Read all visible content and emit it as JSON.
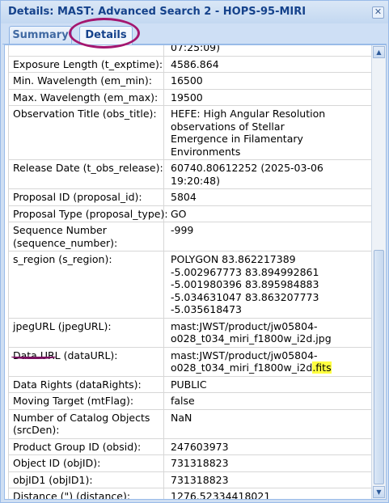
{
  "window": {
    "title": "Details: MAST: Advanced Search 2 - HOPS-95-MIRI",
    "close_glyph": "✕"
  },
  "tabs": [
    {
      "label": "Summary",
      "active": false
    },
    {
      "label": "Details",
      "active": true
    }
  ],
  "rows": [
    {
      "label": [
        ""
      ],
      "value": [
        "07:25:09)"
      ]
    },
    {
      "label": [
        "Exposure Length (t_exptime):"
      ],
      "value": [
        "4586.864"
      ]
    },
    {
      "label": [
        "Min. Wavelength (em_min):"
      ],
      "value": [
        "16500"
      ]
    },
    {
      "label": [
        "Max. Wavelength (em_max):"
      ],
      "value": [
        "19500"
      ]
    },
    {
      "label": [
        "Observation Title (obs_title):"
      ],
      "value": [
        "HEFE: High Angular Resolution",
        "observations of Stellar",
        "Emergence in Filamentary",
        "Environments"
      ]
    },
    {
      "label": [
        "Release Date (t_obs_release):"
      ],
      "value": [
        "60740.80612252 (2025-03-06",
        "19:20:48)"
      ]
    },
    {
      "label": [
        "Proposal ID (proposal_id):"
      ],
      "value": [
        "5804"
      ]
    },
    {
      "label": [
        "Proposal Type (proposal_type):"
      ],
      "value": [
        "GO"
      ]
    },
    {
      "label": [
        "Sequence Number",
        "(sequence_number):"
      ],
      "value": [
        "-999"
      ]
    },
    {
      "label": [
        "s_region (s_region):"
      ],
      "value": [
        "POLYGON 83.862217389",
        "-5.002967773 83.894992861",
        "-5.001980396 83.895984883",
        "-5.034631047 83.863207773",
        "-5.035618473"
      ]
    },
    {
      "label": [
        "jpegURL (jpegURL):"
      ],
      "value": [
        "mast:JWST/product/jw05804-",
        "o028_t034_miri_f1800w_i2d.jpg"
      ]
    },
    {
      "label": [
        "Data URL (dataURL):"
      ],
      "value": [
        "mast:JWST/product/jw05804-",
        "o028_t034_miri_f1800w_i2d"
      ],
      "value_highlight": ".fits"
    },
    {
      "label": [
        "Data Rights (dataRights):"
      ],
      "value": [
        "PUBLIC"
      ]
    },
    {
      "label": [
        "Moving Target (mtFlag):"
      ],
      "value": [
        "false"
      ]
    },
    {
      "label": [
        "Number of Catalog Objects",
        "(srcDen):"
      ],
      "value": [
        "NaN"
      ]
    },
    {
      "label": [
        "Product Group ID (obsid):"
      ],
      "value": [
        "247603973"
      ]
    },
    {
      "label": [
        "Object ID (objID):"
      ],
      "value": [
        "731318823"
      ]
    },
    {
      "label": [
        "objID1 (objID1):"
      ],
      "value": [
        "731318823"
      ]
    },
    {
      "label": [
        "Distance (\") (distance):"
      ],
      "value": [
        "1276.52334418021"
      ]
    }
  ],
  "scrollbar": {
    "up_glyph": "▲",
    "down_glyph": "▼"
  },
  "colors": {
    "title": "#15428b",
    "highlight": "#ffff40",
    "annotation": "#a4166f"
  }
}
